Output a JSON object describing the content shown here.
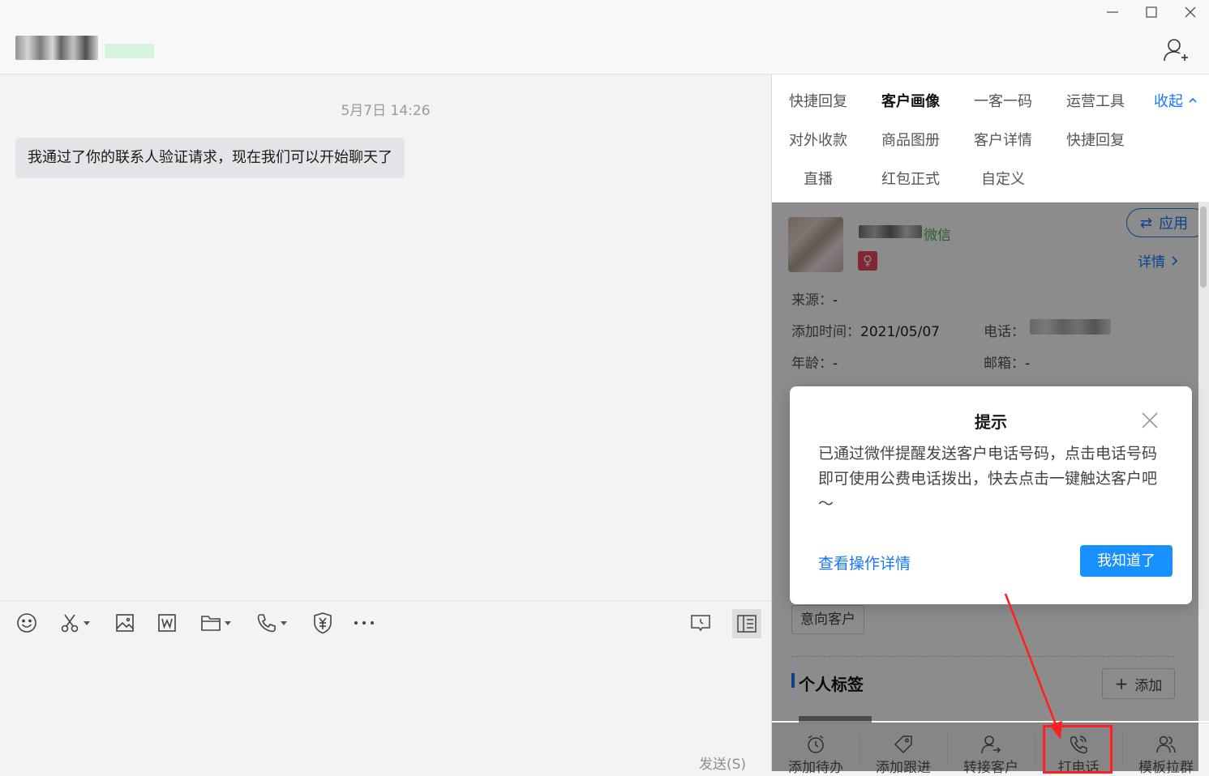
{
  "window": {
    "title_controls": [
      "minimize",
      "maximize",
      "close"
    ]
  },
  "header": {
    "add_contact_icon": "add-user-icon"
  },
  "chat": {
    "timestamp": "5月7日 14:26",
    "messages": [
      {
        "text": "我通过了你的联系人验证请求，现在我们可以开始聊天了"
      }
    ],
    "toolbar": {
      "icons": [
        "emoji-icon",
        "scissors-icon",
        "image-icon",
        "word-doc-icon",
        "folder-icon",
        "phone-icon",
        "red-packet-icon",
        "more-icon",
        "chat-history-icon",
        "sidebar-toggle-icon"
      ]
    },
    "send_label": "发送(S)"
  },
  "right_panel": {
    "nav_row1": [
      "快捷回复",
      "客户画像",
      "一客一码",
      "运营工具"
    ],
    "collapse_label": "收起",
    "nav_row2": [
      "对外收款",
      "商品图册",
      "客户详情",
      "快捷回复"
    ],
    "nav_row3": [
      "直播",
      "红包正式",
      "自定义"
    ],
    "active_tab": "客户画像",
    "customer": {
      "wechat_tag": "微信",
      "gender_icon": "female-icon",
      "apply_label": "应用",
      "details_label": "详情",
      "source_label": "来源：",
      "source_value": "-",
      "added_label": "添加时间：",
      "added_value": "2021/05/07",
      "phone_label": "电话：",
      "age_label": "年龄：",
      "age_value": "-",
      "email_label": "邮箱：",
      "email_value": "-",
      "tag": "意向客户",
      "personal_tags_title": "个人标签",
      "add_label": "添加"
    },
    "actions": [
      {
        "label": "添加待办",
        "icon": "alarm-clock-icon"
      },
      {
        "label": "添加跟进",
        "icon": "tag-icon"
      },
      {
        "label": "转接客户",
        "icon": "transfer-user-icon"
      },
      {
        "label": "打电话",
        "icon": "phone-icon"
      },
      {
        "label": "模板拉群",
        "icon": "group-icon"
      }
    ]
  },
  "dialog": {
    "title": "提示",
    "body": "已通过微伴提醒发送客户电话号码，点击电话号码即可使用公费电话拨出，快去点击一键触达客户吧～",
    "link": "查看操作详情",
    "confirm": "我知道了"
  },
  "colors": {
    "accent": "#1890ff",
    "link": "#1677ff",
    "annotation": "#ff1f1f",
    "wechat_green": "#4caf50"
  }
}
